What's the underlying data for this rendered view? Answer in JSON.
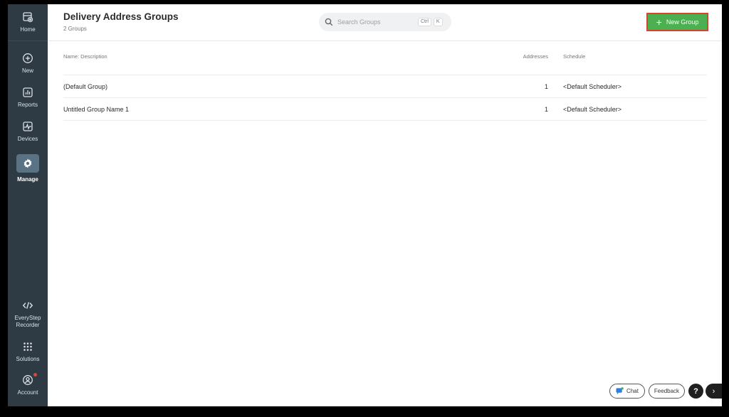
{
  "sidebar": {
    "home": {
      "label": "Home",
      "icon": "home-icon"
    },
    "items": [
      {
        "label": "New",
        "icon": "plus-circle-icon"
      },
      {
        "label": "Reports",
        "icon": "chart-icon"
      },
      {
        "label": "Devices",
        "icon": "devices-icon"
      },
      {
        "label": "Manage",
        "icon": "gear-icon",
        "active": true
      }
    ],
    "bottom": [
      {
        "label_line1": "EveryStep",
        "label_line2": "Recorder",
        "icon": "code-icon"
      },
      {
        "label": "Solutions",
        "icon": "grid-icon"
      },
      {
        "label": "Account",
        "icon": "account-icon",
        "notification": true
      }
    ]
  },
  "header": {
    "title": "Delivery Address Groups",
    "subtitle": "2 Groups",
    "search_placeholder": "Search Groups",
    "shortcut_ctrl": "Ctrl",
    "shortcut_key": "K",
    "new_button": "New Group"
  },
  "table": {
    "columns": {
      "name": "Name: Description",
      "addresses": "Addresses",
      "schedule": "Schedule"
    },
    "rows": [
      {
        "name": "(Default Group)",
        "addresses": "1",
        "schedule": "<Default Scheduler>"
      },
      {
        "name": "Untitled Group Name 1",
        "addresses": "1",
        "schedule": "<Default Scheduler>"
      }
    ]
  },
  "widgets": {
    "chat": "Chat",
    "feedback": "Feedback",
    "help": "?",
    "expand": "›"
  },
  "colors": {
    "sidebar_bg": "#2e3a44",
    "active_nav": "#5a7384",
    "primary_button": "#4caf50",
    "button_outline": "#d6462f",
    "notification": "#e0453a"
  }
}
